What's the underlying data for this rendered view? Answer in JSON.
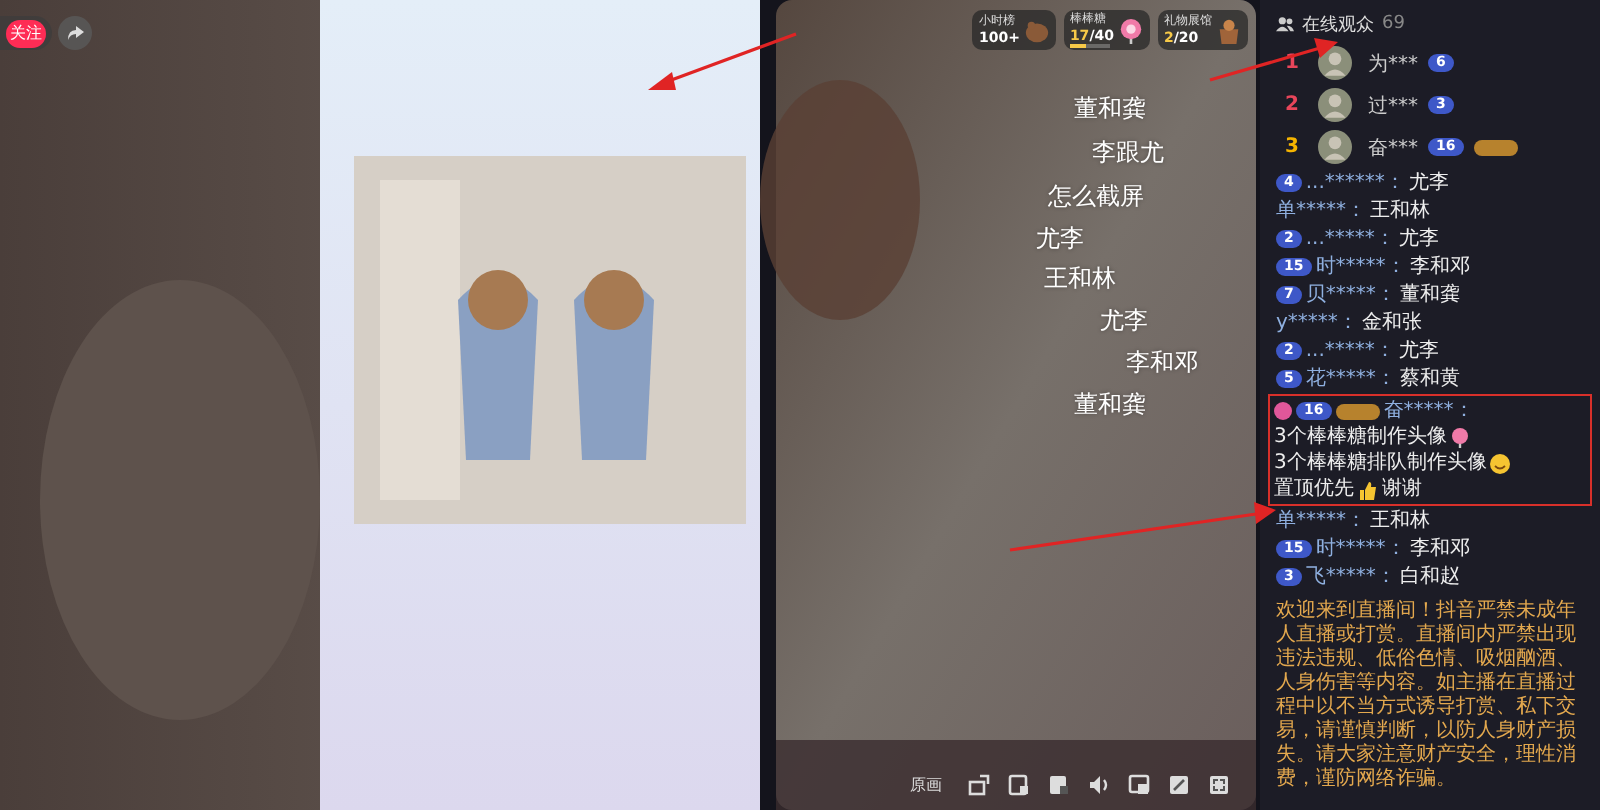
{
  "stream": {
    "follow_label": "关注"
  },
  "stats": [
    {
      "kind": "rank",
      "label": "小时榜",
      "value": "100+"
    },
    {
      "kind": "lollipop",
      "label": "棒棒糖",
      "value": "17",
      "total": "/40",
      "level": 0.425
    },
    {
      "kind": "gallery",
      "label": "礼物展馆",
      "value": "2",
      "total": "/20"
    }
  ],
  "danmaku": [
    {
      "text": "董和龚"
    },
    {
      "text": "李跟尤"
    },
    {
      "text": "怎么截屏"
    },
    {
      "text": "尤李"
    },
    {
      "text": "王和林"
    },
    {
      "text": "尤李"
    },
    {
      "text": "李和邓"
    },
    {
      "text": "董和龚"
    }
  ],
  "controls": {
    "quality": "原画"
  },
  "chat": {
    "title": "在线观众",
    "count": "69",
    "top_viewers": [
      {
        "rank": "1",
        "name": "为***",
        "level": "6",
        "fan_badge": false
      },
      {
        "rank": "2",
        "name": "过***",
        "level": "3",
        "fan_badge": false
      },
      {
        "rank": "3",
        "name": "奋***",
        "level": "16",
        "fan_badge": true
      }
    ],
    "messages": [
      {
        "level": "4",
        "user": "...******：",
        "text": "尤李"
      },
      {
        "user": "单*****：",
        "text": "王和林"
      },
      {
        "level": "2",
        "user": "...*****：",
        "text": "尤李"
      },
      {
        "level": "15",
        "user": "时*****：",
        "text": "李和邓"
      },
      {
        "level": "7",
        "user": "贝*****：",
        "text": "董和龚"
      },
      {
        "user": "y*****：",
        "text": "金和张"
      },
      {
        "level": "2",
        "user": "...*****：",
        "text": "尤李"
      },
      {
        "level": "5",
        "user": "花*****：",
        "text": "蔡和黄"
      },
      {
        "level": "16",
        "fan_badge": true,
        "highlighted": true,
        "user": "奋*****：",
        "segments": [
          "3个棒棒糖制作头像",
          "3个棒棒糖排队制作头像",
          "置顶优先",
          "谢谢"
        ]
      },
      {
        "user": "单*****：",
        "text": "王和林"
      },
      {
        "level": "15",
        "user": "时*****：",
        "text": "李和邓"
      },
      {
        "level": "3",
        "user": "飞*****：",
        "text": "白和赵"
      }
    ],
    "notice": "欢迎来到直播间！抖音严禁未成年人直播或打赏。直播间内严禁出现违法违规、低俗色情、吸烟酗酒、人身伤害等内容。如主播在直播过程中以不当方式诱导打赏、私下交易，请谨慎判断，以防人身财产损失。请大家注意财产安全，理性消费，谨防网络诈骗。"
  }
}
